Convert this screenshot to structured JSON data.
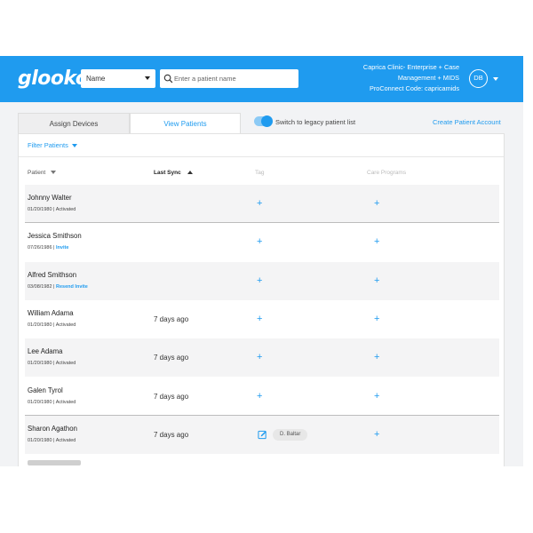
{
  "header": {
    "logo": "glooko",
    "search_type": "Name",
    "search_placeholder": "Enter a patient name",
    "clinic_lines": [
      "Caprica Clinic- Enterprise + Case",
      "Management + MIDS",
      "ProConnect Code: capricamids"
    ],
    "avatar_initials": "DB",
    "colors": {
      "brand": "#1f9bef"
    }
  },
  "tabs": [
    {
      "label": "Assign Devices",
      "active": false
    },
    {
      "label": "View Patients",
      "active": true
    }
  ],
  "toggle": {
    "label": "Switch to legacy patient list",
    "on": true
  },
  "create_account_link": "Create Patient Account",
  "filter_label": "Filter Patients",
  "columns": {
    "patient": "Patient",
    "last_sync": "Last Sync",
    "tag": "Tag",
    "care_programs": "Care Programs"
  },
  "patients": [
    {
      "name": "Johnny Walter",
      "dob": "01/20/1980",
      "status": "Activated",
      "status_link": false,
      "last_sync": "",
      "tag": "",
      "shaded": true,
      "rule": true
    },
    {
      "name": "Jessica Smithson",
      "dob": "07/26/1986",
      "status": "Invite",
      "status_link": true,
      "last_sync": "",
      "tag": "",
      "shaded": false,
      "rule": false
    },
    {
      "name": "Alfred Smithson",
      "dob": "03/08/1982",
      "status": "Resend Invite",
      "status_link": true,
      "last_sync": "",
      "tag": "",
      "shaded": true,
      "rule": false
    },
    {
      "name": "William Adama",
      "dob": "01/20/1980",
      "status": "Activated",
      "status_link": false,
      "last_sync": "7 days ago",
      "tag": "",
      "shaded": false,
      "rule": false
    },
    {
      "name": "Lee Adama",
      "dob": "01/20/1980",
      "status": "Activated",
      "status_link": false,
      "last_sync": "7 days ago",
      "tag": "",
      "shaded": true,
      "rule": false
    },
    {
      "name": "Galen Tyrol",
      "dob": "01/20/1980",
      "status": "Activated",
      "status_link": false,
      "last_sync": "7 days ago",
      "tag": "",
      "shaded": false,
      "rule": true
    },
    {
      "name": "Sharon Agathon",
      "dob": "01/20/1980",
      "status": "Activated",
      "status_link": false,
      "last_sync": "7 days ago",
      "tag": "D. Baltar",
      "shaded": true,
      "rule": false
    }
  ],
  "add_icon": "+"
}
